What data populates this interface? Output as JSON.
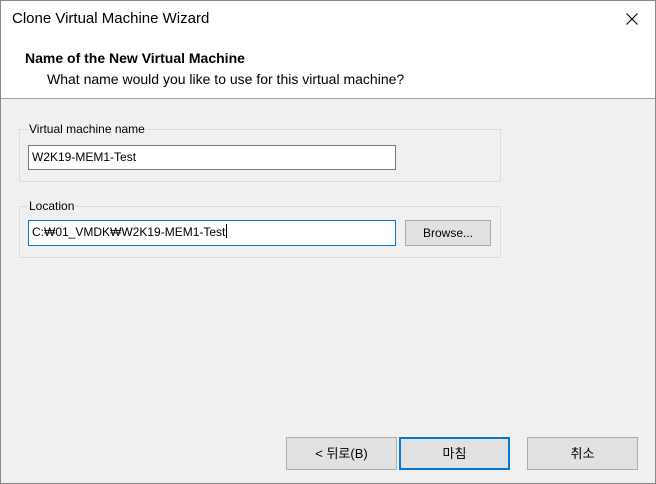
{
  "window": {
    "title": "Clone Virtual Machine Wizard"
  },
  "header": {
    "title": "Name of the New Virtual Machine",
    "subtitle": "What name would you like to use for this virtual machine?"
  },
  "vm_name": {
    "label": "Virtual machine name",
    "value": "W2K19-MEM1-Test"
  },
  "location": {
    "label": "Location",
    "value": "C:₩01_VMDK₩W2K19-MEM1-Test",
    "browse_label": "Browse..."
  },
  "footer": {
    "back_label": "< 뒤로(B)",
    "finish_label": "마침",
    "cancel_label": "취소"
  },
  "colors": {
    "focus_accent": "#0078d7",
    "dialog_bg": "#f0f0f0"
  }
}
